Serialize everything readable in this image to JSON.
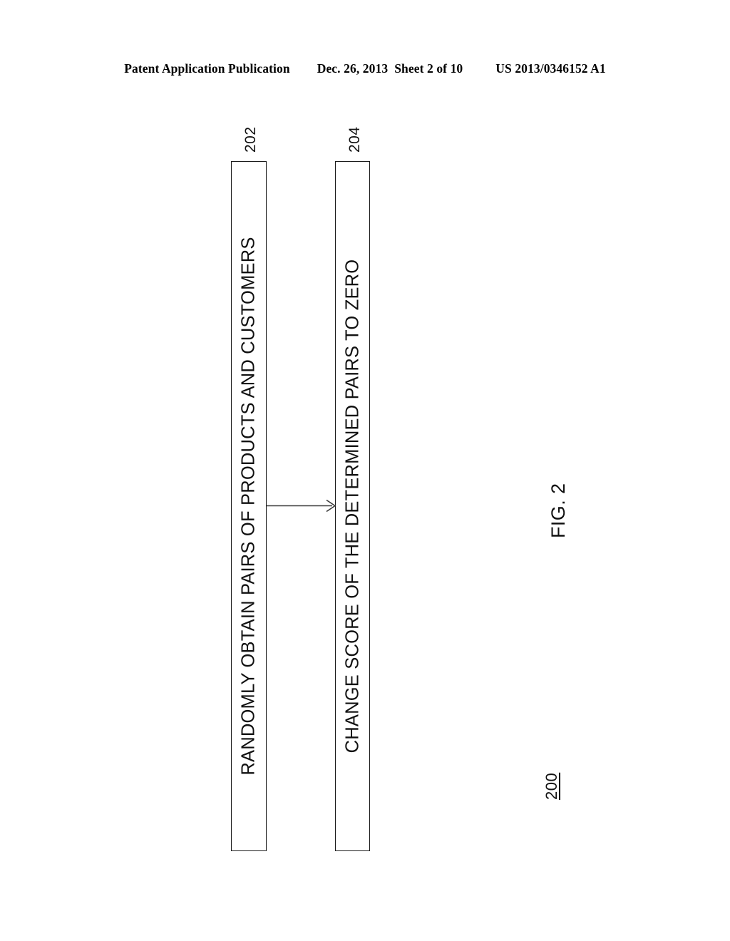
{
  "header": {
    "publication": "Patent Application Publication",
    "date": "Dec. 26, 2013",
    "sheet": "Sheet 2 of 10",
    "patent_number": "US 2013/0346152 A1"
  },
  "figure": {
    "caption": "FIG. 2",
    "flow_reference": "200",
    "boxes": [
      {
        "ref": "202",
        "label": "RANDOMLY OBTAIN PAIRS OF PRODUCTS AND CUSTOMERS"
      },
      {
        "ref": "204",
        "label": "CHANGE SCORE OF THE DETERMINED PAIRS TO ZERO"
      }
    ],
    "connector": {
      "from": "202",
      "to": "204",
      "arrow": "arrow-right"
    }
  }
}
